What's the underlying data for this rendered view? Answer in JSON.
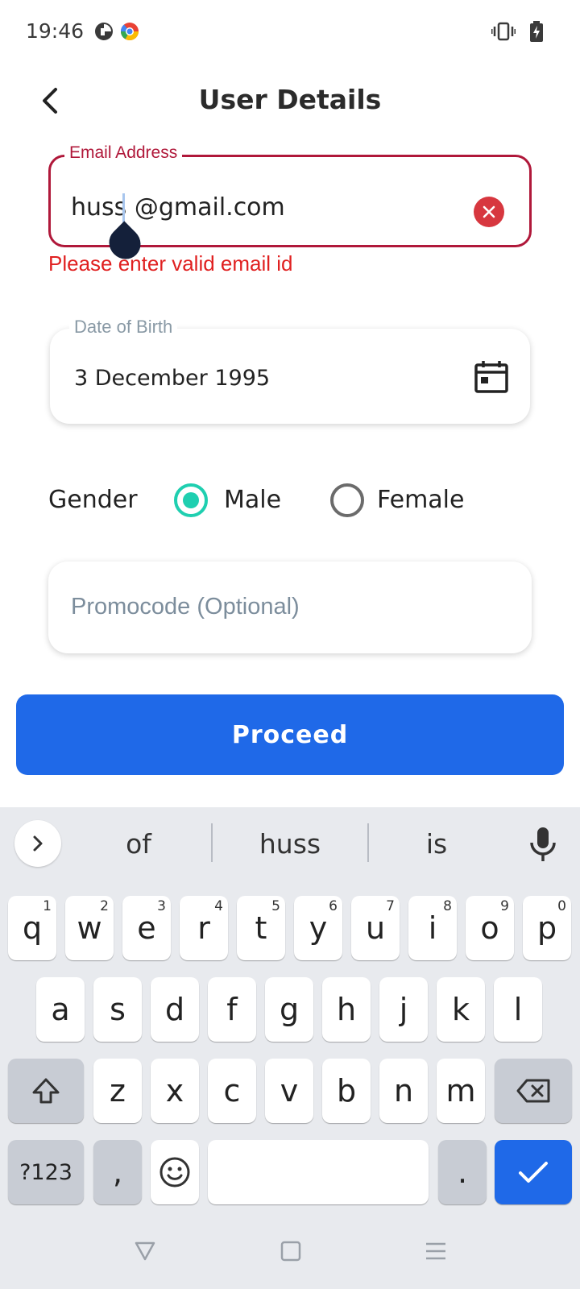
{
  "status_bar": {
    "time": "19:46",
    "left_icons": [
      "app-notification-icon",
      "chrome-notification-icon"
    ],
    "right_icons": [
      "vibrate-icon",
      "battery-charging-icon"
    ]
  },
  "header": {
    "title": "User Details",
    "back_icon": "back-arrow-icon"
  },
  "email": {
    "label": "Email Address",
    "value_before_cursor": "huss",
    "value_after_cursor": " @gmail.com",
    "error": "Please enter valid email id",
    "clear_icon": "clear-icon",
    "error_color": "#b0183a"
  },
  "dob": {
    "label": "Date of Birth",
    "value": "3 December 1995",
    "icon": "calendar-icon"
  },
  "gender": {
    "label": "Gender",
    "options": [
      {
        "label": "Male",
        "selected": true
      },
      {
        "label": "Female",
        "selected": false
      }
    ],
    "selected_color": "#1fcfb0"
  },
  "promo": {
    "placeholder": "Promocode (Optional)",
    "value": ""
  },
  "proceed": {
    "label": "Proceed",
    "color": "#1f69e8"
  },
  "keyboard": {
    "suggestions": [
      "of",
      "huss",
      "is"
    ],
    "row1": [
      {
        "key": "q",
        "hint": "1"
      },
      {
        "key": "w",
        "hint": "2"
      },
      {
        "key": "e",
        "hint": "3"
      },
      {
        "key": "r",
        "hint": "4"
      },
      {
        "key": "t",
        "hint": "5"
      },
      {
        "key": "y",
        "hint": "6"
      },
      {
        "key": "u",
        "hint": "7"
      },
      {
        "key": "i",
        "hint": "8"
      },
      {
        "key": "o",
        "hint": "9"
      },
      {
        "key": "p",
        "hint": "0"
      }
    ],
    "row2": [
      "a",
      "s",
      "d",
      "f",
      "g",
      "h",
      "j",
      "k",
      "l"
    ],
    "row3": [
      "z",
      "x",
      "c",
      "v",
      "b",
      "n",
      "m"
    ],
    "symbols_label": "?123",
    "comma": ",",
    "period": ".",
    "icons": [
      "expand-icon",
      "mic-icon",
      "shift-icon",
      "backspace-icon",
      "emoji-icon",
      "done-check-icon"
    ]
  },
  "nav_bar": {
    "icons": [
      "nav-back-icon",
      "nav-home-icon",
      "nav-recents-icon"
    ]
  }
}
